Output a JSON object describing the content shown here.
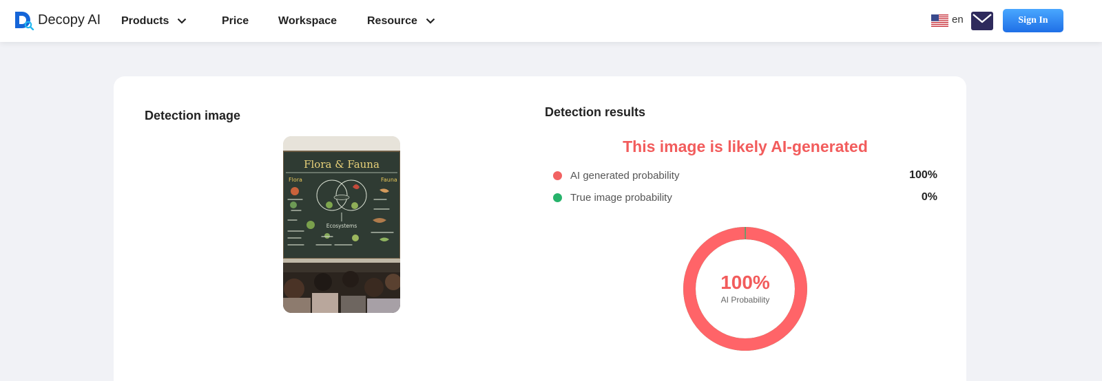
{
  "brand": {
    "name": "Decopy AI"
  },
  "nav": [
    {
      "label": "Products",
      "has_dropdown": true
    },
    {
      "label": "Price",
      "has_dropdown": false
    },
    {
      "label": "Workspace",
      "has_dropdown": false
    },
    {
      "label": "Resource",
      "has_dropdown": true
    }
  ],
  "header": {
    "language": "en",
    "sign_in_label": "Sign In"
  },
  "detection": {
    "image_title": "Detection image",
    "results_title": "Detection results",
    "verdict": "This image is likely AI-generated",
    "rows": [
      {
        "label": "AI generated probability",
        "value": "100%",
        "color": "#f26262"
      },
      {
        "label": "True image probability",
        "value": "0%",
        "color": "#27b36b"
      }
    ],
    "gauge": {
      "ai_probability": 100,
      "display": "100%",
      "caption": "AI Probability"
    }
  },
  "thumbnail": {
    "title": "Flora & Fauna",
    "labels": {
      "flora": "Flora",
      "fauna": "Fauna",
      "ecosystems": "Ecosystems"
    }
  },
  "colors": {
    "accent": "#f25c5c",
    "brand_blue": "#1f6fe6",
    "true_green": "#27b36b"
  }
}
